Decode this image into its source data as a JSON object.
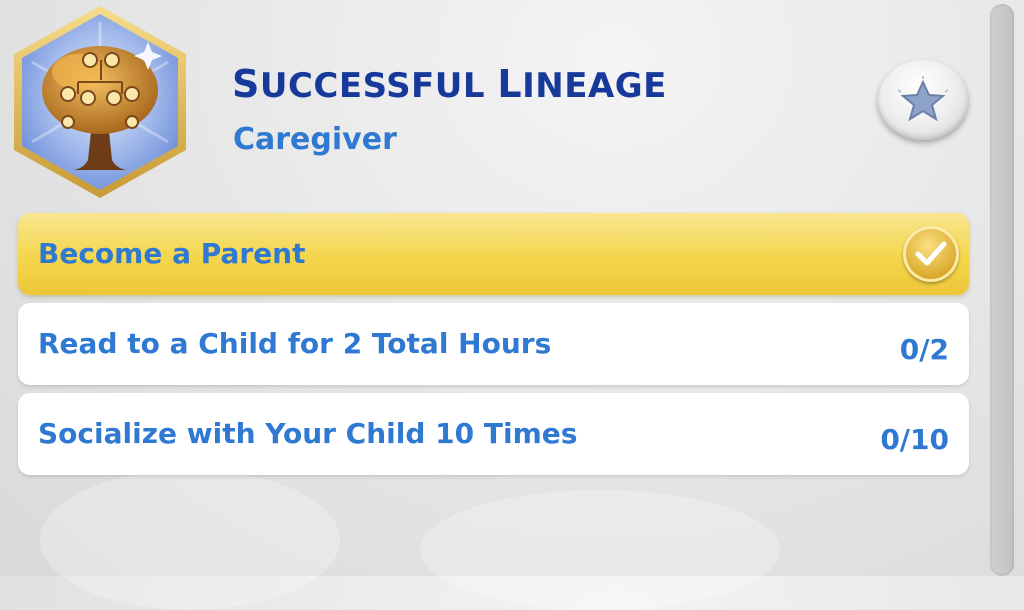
{
  "aspiration": {
    "title": "Successful Lineage",
    "category": "Caregiver",
    "badge_icon": "family-tree-icon",
    "action_icon": "star-icon"
  },
  "milestones": [
    {
      "label": "Become a Parent",
      "status": "complete",
      "icon": "checkmark-icon"
    },
    {
      "label": "Read to a Child for 2 Total Hours",
      "progress": "0/2"
    },
    {
      "label": "Socialize with Your Child 10 Times",
      "progress": "0/10"
    }
  ],
  "colors": {
    "title": "#173a9a",
    "text": "#2f79d3",
    "complete_bg": "#f4d64c"
  }
}
